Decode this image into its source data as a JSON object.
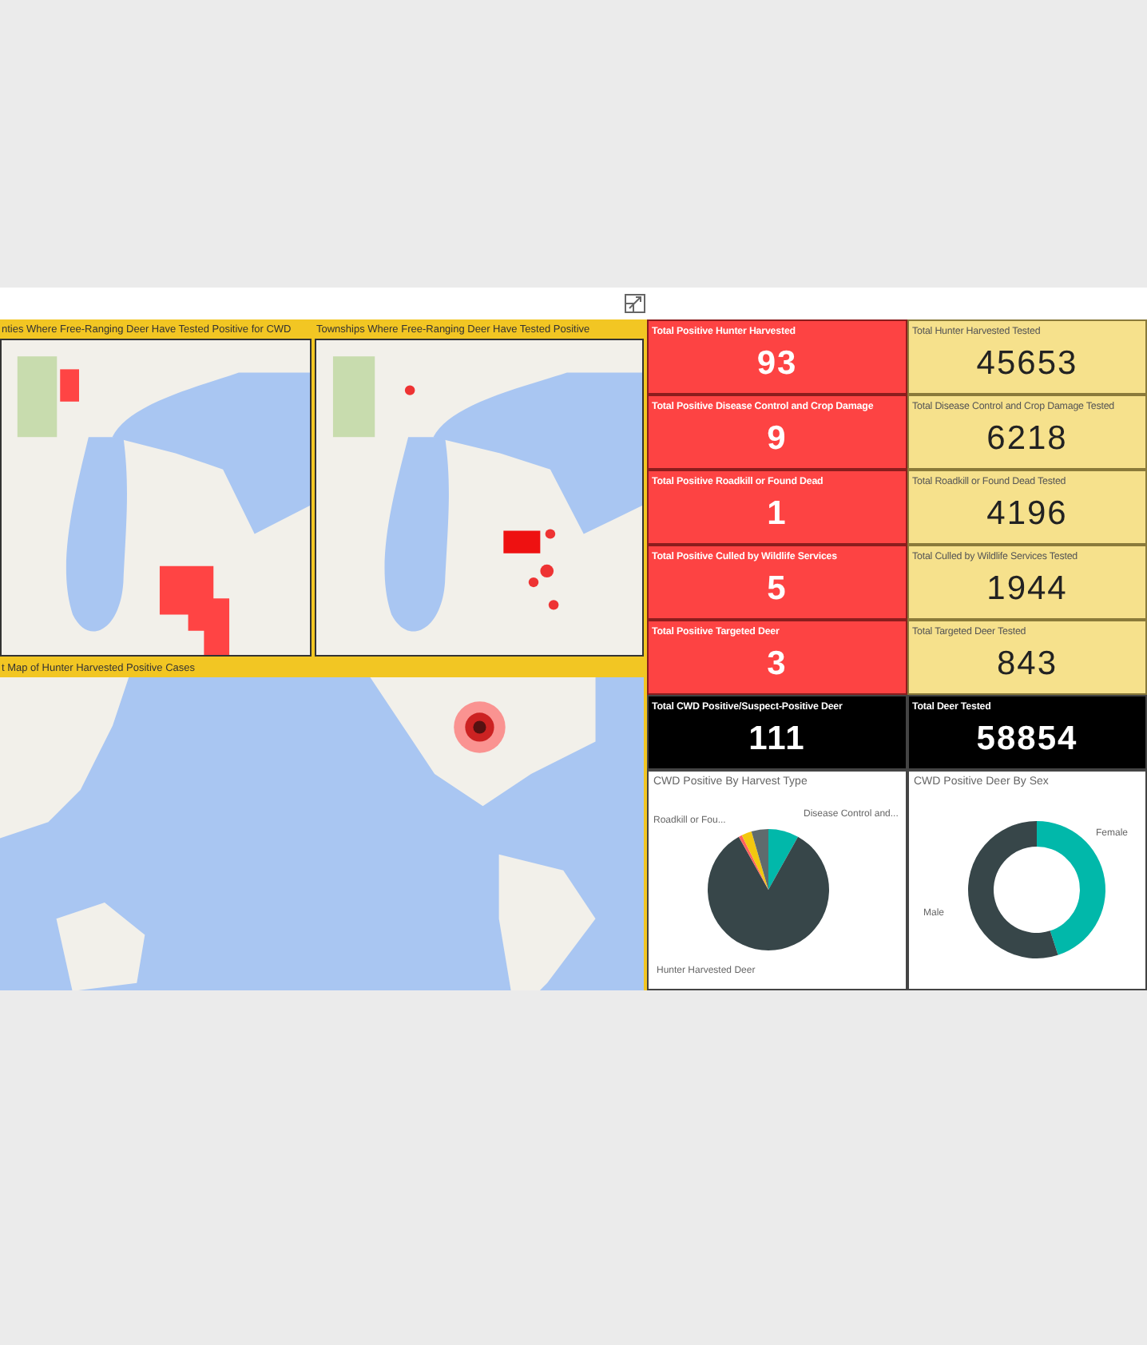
{
  "maps": [
    {
      "title": "nties Where Free-Ranging Deer Have Tested Positive for CWD",
      "kind": "regions"
    },
    {
      "title": "Townships Where Free-Ranging Deer Have Tested Positive",
      "kind": "points"
    },
    {
      "title": "t Map of Hunter Harvested Positive Cases",
      "kind": "heatmap"
    }
  ],
  "kpis": [
    {
      "label": "Total Positive Hunter Harvested",
      "value": "93",
      "kind": "positive"
    },
    {
      "label": "Total Hunter Harvested Tested",
      "value": "45653",
      "kind": "tested"
    },
    {
      "label": "Total Positive Disease Control and Crop Damage",
      "value": "9",
      "kind": "positive"
    },
    {
      "label": "Total Disease Control and Crop Damage Tested",
      "value": "6218",
      "kind": "tested"
    },
    {
      "label": "Total Positive Roadkill or Found Dead",
      "value": "1",
      "kind": "positive"
    },
    {
      "label": "Total Roadkill or Found Dead Tested",
      "value": "4196",
      "kind": "tested"
    },
    {
      "label": "Total Positive Culled by Wildlife Services",
      "value": "5",
      "kind": "positive"
    },
    {
      "label": "Total Culled by Wildlife Services Tested",
      "value": "1944",
      "kind": "tested"
    },
    {
      "label": "Total Positive Targeted Deer",
      "value": "3",
      "kind": "positive"
    },
    {
      "label": "Total Targeted Deer Tested",
      "value": "843",
      "kind": "tested"
    },
    {
      "label": "Total CWD Positive/Suspect-Positive Deer",
      "value": "111",
      "kind": "total"
    },
    {
      "label": "Total Deer Tested",
      "value": "58854",
      "kind": "total"
    }
  ],
  "charts": [
    {
      "title": "CWD Positive By Harvest Type",
      "kind": "pie",
      "labels": [
        "Roadkill or Fou...",
        "Disease Control and...",
        "Hunter Harvested Deer"
      ]
    },
    {
      "title": "CWD Positive Deer By Sex",
      "kind": "donut",
      "labels": [
        "Female",
        "Male"
      ]
    }
  ]
}
